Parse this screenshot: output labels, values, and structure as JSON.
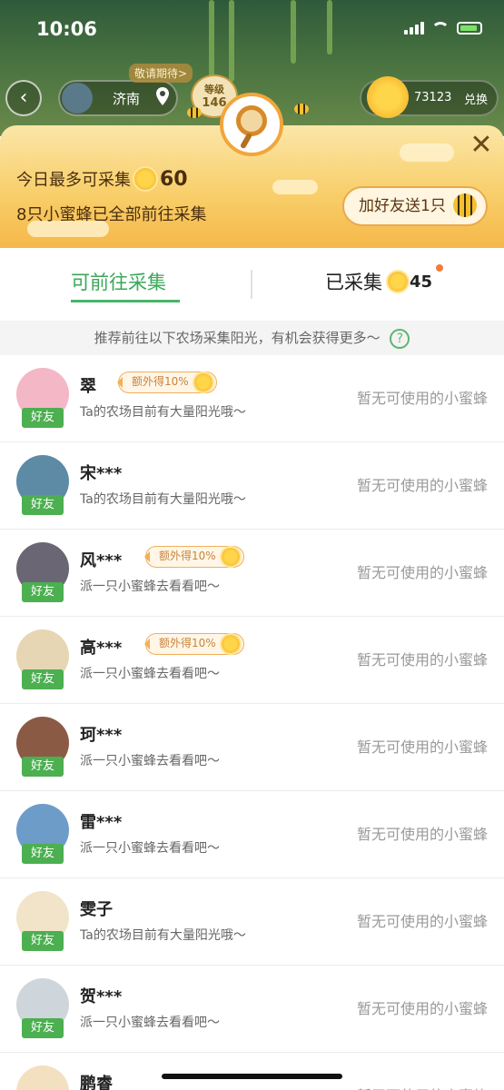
{
  "status_bar": {
    "time": "10:06"
  },
  "game_header": {
    "back_icon": "chevron-left-icon",
    "location": "济南",
    "invite_tag": "敬请期待>",
    "level_label": "等级",
    "level_value": "146",
    "sun_count": "73123",
    "swap_label": "兑换"
  },
  "modal": {
    "today_prefix": "今日最多可采集",
    "today_value": "60",
    "bees_text": "8只小蜜蜂已全部前往采集",
    "add_friend_label": "加好友送1只",
    "close_icon": "close-icon"
  },
  "tabs": {
    "available": "可前往采集",
    "collected": "已采集",
    "collected_count": "45"
  },
  "tip": {
    "text": "推荐前往以下农场采集阳光，有机会获得更多～",
    "help_icon": "?"
  },
  "friend_tag": "好友",
  "rows": [
    {
      "name": "翠",
      "bonus": "额外得10%",
      "desc": "Ta的农场目前有大量阳光哦～",
      "status": "暂无可使用的小蜜蜂",
      "avatar_color": "#f4b7c6"
    },
    {
      "name": "宋***",
      "bonus": "",
      "desc": "Ta的农场目前有大量阳光哦～",
      "status": "暂无可使用的小蜜蜂",
      "avatar_color": "#5d8aa5"
    },
    {
      "name": "风***",
      "bonus": "额外得10%",
      "desc": "派一只小蜜蜂去看看吧～",
      "status": "暂无可使用的小蜜蜂",
      "avatar_color": "#6b6674"
    },
    {
      "name": "高***",
      "bonus": "额外得10%",
      "desc": "派一只小蜜蜂去看看吧～",
      "status": "暂无可使用的小蜜蜂",
      "avatar_color": "#e7d6b3"
    },
    {
      "name": "珂***",
      "bonus": "",
      "desc": "派一只小蜜蜂去看看吧～",
      "status": "暂无可使用的小蜜蜂",
      "avatar_color": "#8a5a45"
    },
    {
      "name": "雷***",
      "bonus": "",
      "desc": "派一只小蜜蜂去看看吧～",
      "status": "暂无可使用的小蜜蜂",
      "avatar_color": "#6d9cc9"
    },
    {
      "name": "雯子",
      "bonus": "",
      "desc": "Ta的农场目前有大量阳光哦～",
      "status": "暂无可使用的小蜜蜂",
      "avatar_color": "#f1e4c8"
    },
    {
      "name": "贺***",
      "bonus": "",
      "desc": "派一只小蜜蜂去看看吧～",
      "status": "暂无可使用的小蜜蜂",
      "avatar_color": "#cfd6db"
    },
    {
      "name": "鹏睿",
      "bonus": "",
      "desc": "",
      "status": "暂无可使用的小蜜蜂",
      "avatar_color": "#f3e0c0"
    }
  ]
}
